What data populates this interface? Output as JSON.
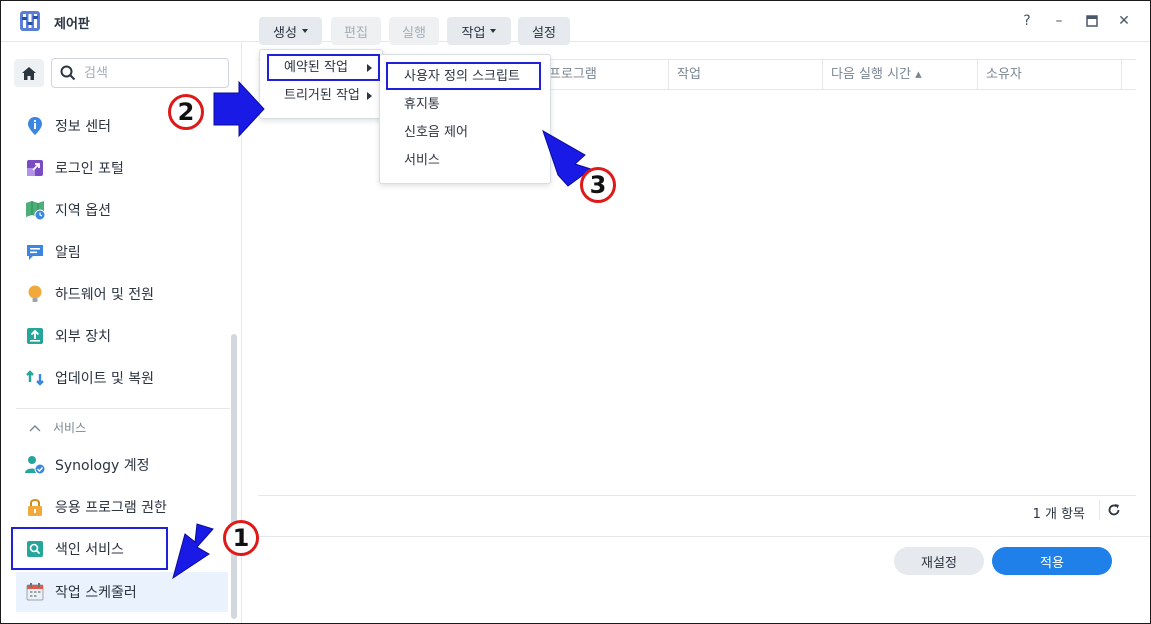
{
  "window": {
    "title": "제어판",
    "help": "?",
    "minimize": "–",
    "maximize": "▭",
    "close": "✕"
  },
  "sidebar": {
    "search_placeholder": "검색",
    "items": [
      {
        "label": "정보 센터",
        "icon": "info-icon"
      },
      {
        "label": "로그인 포털",
        "icon": "login-portal-icon"
      },
      {
        "label": "지역 옵션",
        "icon": "regional-options-icon"
      },
      {
        "label": "알림",
        "icon": "notification-icon"
      },
      {
        "label": "하드웨어 및 전원",
        "icon": "hardware-power-icon"
      },
      {
        "label": "외부 장치",
        "icon": "external-devices-icon"
      },
      {
        "label": "업데이트 및 복원",
        "icon": "update-restore-icon"
      }
    ],
    "section_title": "서비스",
    "service_items": [
      {
        "label": "Synology 계정",
        "icon": "synology-account-icon"
      },
      {
        "label": "응용 프로그램 권한",
        "icon": "app-privileges-icon"
      },
      {
        "label": "색인 서비스",
        "icon": "indexing-service-icon"
      },
      {
        "label": "작업 스케줄러",
        "icon": "task-scheduler-icon",
        "active": true
      }
    ]
  },
  "toolbar": {
    "create": "생성",
    "edit": "편집",
    "run": "실행",
    "action": "작업",
    "settings": "설정"
  },
  "table": {
    "columns": [
      "프로그램",
      "작업",
      "다음 실행 시간 ▴",
      "소유자"
    ]
  },
  "create_menu": {
    "items": [
      "예약된 작업",
      "트리거된 작업"
    ]
  },
  "scheduled_submenu": {
    "items": [
      "사용자 정의 스크립트",
      "휴지통",
      "신호음 제어",
      "서비스"
    ]
  },
  "footer": {
    "item_count": "1 개 항목",
    "reset": "재설정",
    "apply": "적용"
  },
  "annotations": {
    "step1": "1",
    "step2": "2",
    "step3": "3",
    "box_color": "#2020d8",
    "arrow_color": "#1a1ae6",
    "badge_color": "#e01818"
  }
}
